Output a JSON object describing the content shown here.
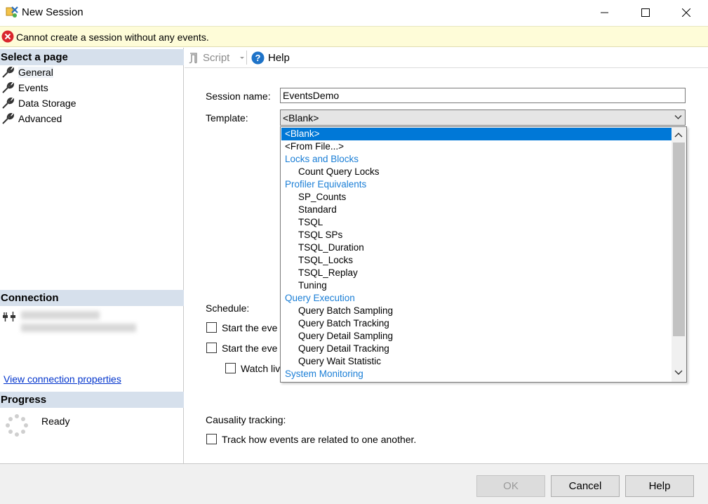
{
  "window": {
    "title": "New Session",
    "minimize_icon": "minimize-icon",
    "maximize_icon": "maximize-icon",
    "close_icon": "close-icon"
  },
  "error_bar": {
    "icon": "error-icon",
    "message": "Cannot create a session without any events."
  },
  "left_panel": {
    "select_page_header": "Select a page",
    "pages": [
      {
        "label": "General",
        "icon": "wrench-icon",
        "selected": true
      },
      {
        "label": "Events",
        "icon": "wrench-icon",
        "selected": false
      },
      {
        "label": "Data Storage",
        "icon": "wrench-icon",
        "selected": false
      },
      {
        "label": "Advanced",
        "icon": "wrench-icon",
        "selected": false
      }
    ],
    "connection_header": "Connection",
    "view_connection_link": "View connection properties",
    "progress_header": "Progress",
    "progress_status": "Ready"
  },
  "toolbar": {
    "script_label": "Script",
    "help_label": "Help"
  },
  "general": {
    "session_name_label": "Session name:",
    "session_name_value": "EventsDemo",
    "template_label": "Template:",
    "template_value": "<Blank>",
    "schedule_label": "Schedule:",
    "start_event_1": "Start the eve",
    "start_event_2": "Start the eve",
    "watch_live": "Watch liv",
    "causality_label": "Causality tracking:",
    "track_label": "Track how events are related to one another."
  },
  "template_dropdown": [
    {
      "label": "<Blank>",
      "kind": "top",
      "selected": true
    },
    {
      "label": "<From File...>",
      "kind": "top",
      "selected": false
    },
    {
      "label": "Locks and Blocks",
      "kind": "cat",
      "selected": false
    },
    {
      "label": "Count Query Locks",
      "kind": "sub",
      "selected": false
    },
    {
      "label": "Profiler Equivalents",
      "kind": "cat",
      "selected": false
    },
    {
      "label": "SP_Counts",
      "kind": "sub",
      "selected": false
    },
    {
      "label": "Standard",
      "kind": "sub",
      "selected": false
    },
    {
      "label": "TSQL",
      "kind": "sub",
      "selected": false
    },
    {
      "label": "TSQL SPs",
      "kind": "sub",
      "selected": false
    },
    {
      "label": "TSQL_Duration",
      "kind": "sub",
      "selected": false
    },
    {
      "label": "TSQL_Locks",
      "kind": "sub",
      "selected": false
    },
    {
      "label": "TSQL_Replay",
      "kind": "sub",
      "selected": false
    },
    {
      "label": "Tuning",
      "kind": "sub",
      "selected": false
    },
    {
      "label": "Query Execution",
      "kind": "cat",
      "selected": false
    },
    {
      "label": "Query Batch Sampling",
      "kind": "sub",
      "selected": false
    },
    {
      "label": "Query Batch Tracking",
      "kind": "sub",
      "selected": false
    },
    {
      "label": "Query Detail Sampling",
      "kind": "sub",
      "selected": false
    },
    {
      "label": "Query Detail Tracking",
      "kind": "sub",
      "selected": false
    },
    {
      "label": "Query Wait Statistic",
      "kind": "sub",
      "selected": false
    },
    {
      "label": "System Monitoring",
      "kind": "cat",
      "selected": false
    }
  ],
  "footer": {
    "ok_label": "OK",
    "cancel_label": "Cancel",
    "help_label": "Help"
  },
  "colors": {
    "category_text": "#1a7ed6",
    "selection": "#0078d7",
    "section_header": "#d6e0ec",
    "error_bar": "#fefcd8"
  }
}
